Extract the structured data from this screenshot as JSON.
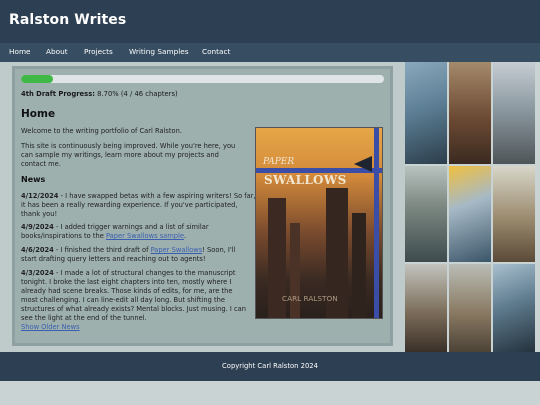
{
  "site": {
    "title": "Ralston Writes"
  },
  "nav": [
    "Home",
    "About",
    "Projects",
    "Writing Samples",
    "Contact"
  ],
  "progress": {
    "label": "4th Draft Progress:",
    "text": " 8.70% (4 / 46 chapters)",
    "fraction": 0.087
  },
  "home": {
    "heading": "Home",
    "intro1": "Welcome to the writing portfolio of Carl Ralston.",
    "intro2a": "This site is continuously being improved. While you're here, you",
    "intro2b": "can sample my writings, learn more about my projects and",
    "intro2c": "contact me."
  },
  "news": {
    "heading": "News",
    "items": [
      {
        "date": "4/12/2024",
        "lines": [
          " - I have swapped betas with a few aspiring writers! So far,",
          "it has been a really rewarding experience. If you've participated,",
          "thank you!"
        ]
      },
      {
        "date": "4/9/2024",
        "lines": [
          " - I added trigger warnings and a list of similar",
          "books/inspirations to the "
        ],
        "link": "Paper Swallows sample",
        "after": "."
      },
      {
        "date": "4/6/2024",
        "lines": [
          " - I finished the third draft of "
        ],
        "link": "Paper Swallows",
        "after": "! Soon, I'll",
        "tail": "start drafting query letters and reaching out to agents!"
      },
      {
        "date": "4/3/2024",
        "lines": [
          " - I made a lot of structural changes to the manuscript",
          "tonight. I broke the last eight chapters into ten, mostly where I",
          "already had scene breaks. Those kinds of edits, for me, are the",
          "most challenging. I can line-edit all day long. But shifting the",
          "structures of what already exists? Mental blocks. Just musing. I can",
          "see the light at the end of the tunnel."
        ]
      }
    ],
    "older_link": "Show Older News"
  },
  "cover": {
    "title_top": "PAPER",
    "title_main": "SWALLOWS",
    "author": "CARL RALSTON"
  },
  "footer": {
    "text": "Copyright Carl Ralston 2024"
  },
  "colors": {
    "header": "#2d3f52",
    "nav": "#374d61",
    "progress": "#3fb845",
    "link": "#3a5fb0"
  }
}
